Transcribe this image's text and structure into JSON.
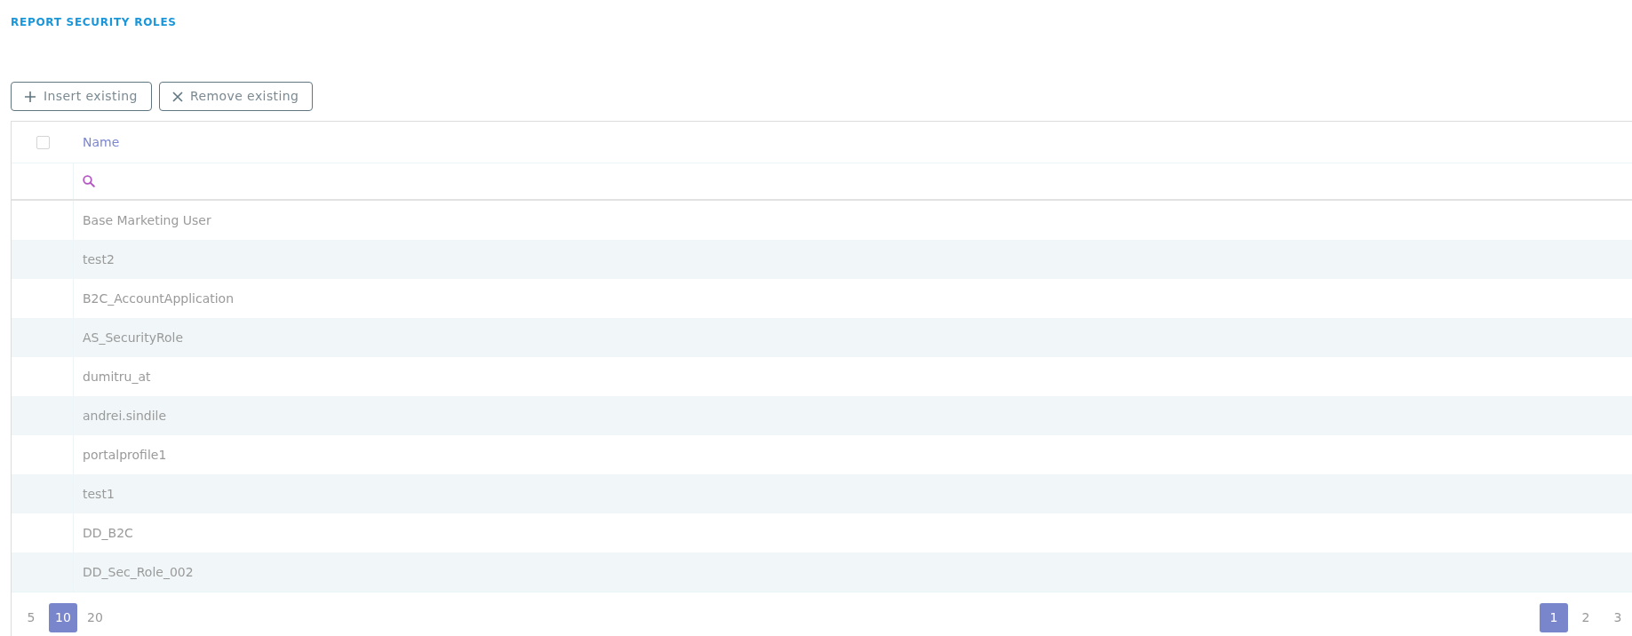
{
  "title": "REPORT SECURITY ROLES",
  "toolbar": [
    {
      "kind": "insert",
      "label": "Insert existing"
    },
    {
      "kind": "remove",
      "label": "Remove existing"
    }
  ],
  "table": {
    "select_all": {
      "checked": false
    },
    "columns": [
      "Name"
    ],
    "rows": [
      {
        "name": "Base Marketing User"
      },
      {
        "name": "test2"
      },
      {
        "name": "B2C_AccountApplication"
      },
      {
        "name": "AS_SecurityRole"
      },
      {
        "name": "dumitru_at"
      },
      {
        "name": "andrei.sindile"
      },
      {
        "name": "portalprofile1"
      },
      {
        "name": "test1"
      },
      {
        "name": "DD_B2C"
      },
      {
        "name": "DD_Sec_Role_002"
      }
    ]
  },
  "page_sizes": [
    {
      "label": "5",
      "selected": false
    },
    {
      "label": "10",
      "selected": true
    },
    {
      "label": "20",
      "selected": false
    }
  ],
  "pages": [
    {
      "label": "1",
      "selected": true
    },
    {
      "label": "2",
      "selected": false
    },
    {
      "label": "3",
      "selected": false
    }
  ]
}
